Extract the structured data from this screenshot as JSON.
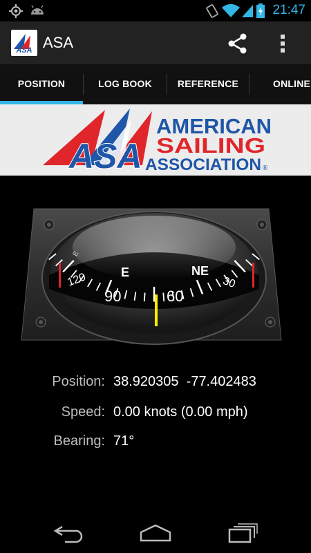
{
  "status_bar": {
    "time": "21:47",
    "icons": [
      "gps-icon",
      "android-icon",
      "vibrate-icon",
      "wifi-icon",
      "signal-icon",
      "battery-charging-icon"
    ]
  },
  "action_bar": {
    "title": "ASA",
    "logo_text": "ASA",
    "actions": [
      "share-icon",
      "overflow-menu-icon"
    ]
  },
  "tabs": [
    {
      "label": "POSITION",
      "selected": true
    },
    {
      "label": "LOG BOOK",
      "selected": false
    },
    {
      "label": "REFERENCE",
      "selected": false
    },
    {
      "label": "ONLINE",
      "selected": false
    }
  ],
  "banner": {
    "logo_text": "ASA",
    "line1": "AMERICAN",
    "line2": "SAILING",
    "line3": "ASSOCIATION",
    "registered": "®",
    "colors": {
      "blue": "#1f56a8",
      "red": "#e0262b"
    }
  },
  "compass": {
    "bearing_deg": 71,
    "cardinals": [
      {
        "label": "E"
      },
      {
        "label": "NE"
      }
    ],
    "degree_labels": [
      "120",
      "90",
      "60",
      "30"
    ],
    "partial_label": "E"
  },
  "readings": {
    "position_label": "Position:",
    "position_value": "38.920305  -77.402483",
    "speed_label": "Speed:",
    "speed_value": "0.00 knots (0.00 mph)",
    "bearing_label": "Bearing:",
    "bearing_value": "71°"
  },
  "nav_bar": [
    "back-icon",
    "home-icon",
    "recent-apps-icon"
  ]
}
